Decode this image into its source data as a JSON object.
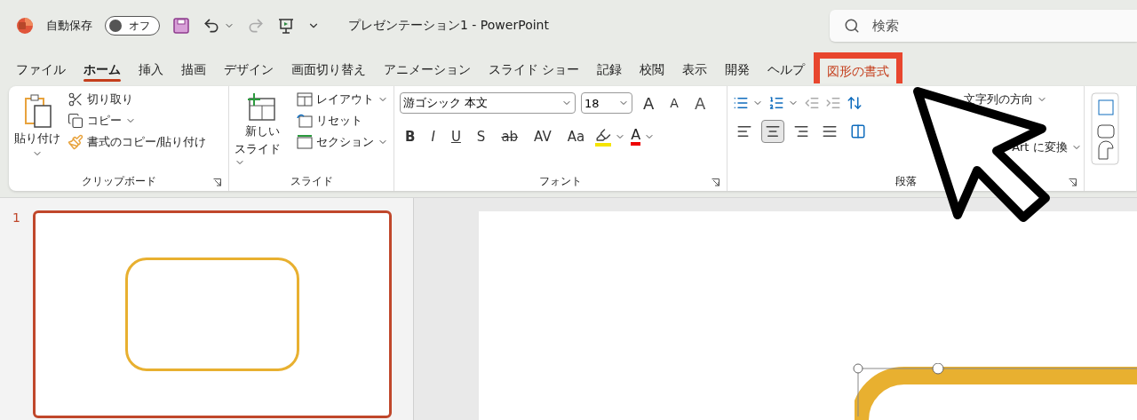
{
  "title_bar": {
    "autosave_label": "自動保存",
    "autosave_toggle": {
      "on": false,
      "label": "オフ"
    },
    "title": "プレゼンテーション1  -  PowerPoint",
    "search": {
      "placeholder": "検索"
    }
  },
  "tabs": [
    {
      "label": "ファイル",
      "selected": false,
      "highlighted": false
    },
    {
      "label": "ホーム",
      "selected": true,
      "highlighted": false
    },
    {
      "label": "挿入",
      "selected": false,
      "highlighted": false
    },
    {
      "label": "描画",
      "selected": false,
      "highlighted": false
    },
    {
      "label": "デザイン",
      "selected": false,
      "highlighted": false
    },
    {
      "label": "画面切り替え",
      "selected": false,
      "highlighted": false
    },
    {
      "label": "アニメーション",
      "selected": false,
      "highlighted": false
    },
    {
      "label": "スライド ショー",
      "selected": false,
      "highlighted": false
    },
    {
      "label": "記録",
      "selected": false,
      "highlighted": false
    },
    {
      "label": "校閲",
      "selected": false,
      "highlighted": false
    },
    {
      "label": "表示",
      "selected": false,
      "highlighted": false
    },
    {
      "label": "開発",
      "selected": false,
      "highlighted": false
    },
    {
      "label": "ヘルプ",
      "selected": false,
      "highlighted": false
    },
    {
      "label": "図形の書式",
      "selected": false,
      "highlighted": true
    }
  ],
  "clipboard": {
    "paste": "貼り付け",
    "cut": "切り取り",
    "copy": "コピー",
    "format_painter": "書式のコピー/貼り付け",
    "title": "クリップボード"
  },
  "slides_group": {
    "new_slide": [
      "新しい",
      "スライド"
    ],
    "layout": "レイアウト",
    "reset": "リセット",
    "section": "セクション",
    "title": "スライド"
  },
  "font": {
    "font_name": "游ゴシック 本文",
    "font_size": "18",
    "grow": "A",
    "shrink": "A",
    "clear": "A",
    "styles": [
      "B",
      "I",
      "U",
      "S",
      "ab",
      "AV",
      "Aa"
    ],
    "font_color": "A",
    "title": "フォント"
  },
  "paragraph": {
    "alignments": [
      {
        "selected": false
      },
      {
        "selected": true
      },
      {
        "selected": false
      },
      {
        "selected": false
      },
      {
        "selected": false
      }
    ],
    "text_direction": "文字列の方向",
    "convert": "Art に変換",
    "title": "段落"
  },
  "slide_panel": {
    "slides": [
      {
        "number": "1",
        "selected": true
      }
    ]
  }
}
